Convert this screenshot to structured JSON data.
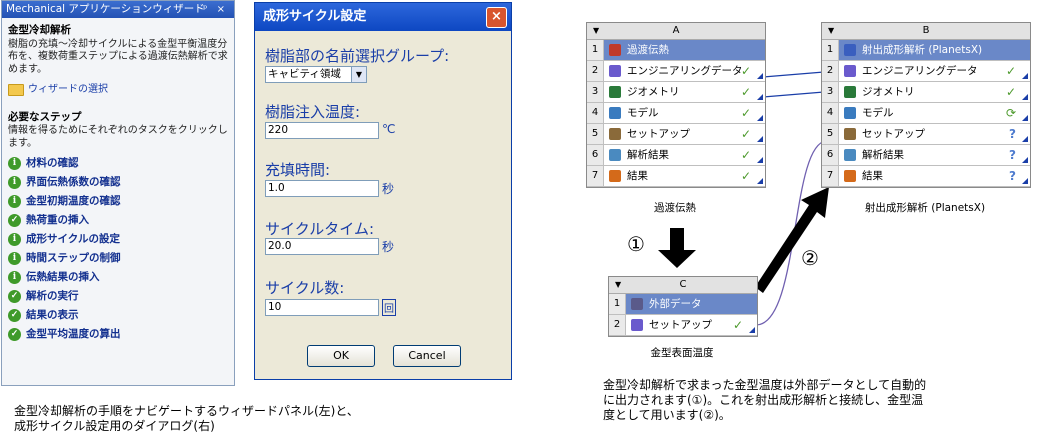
{
  "wizard": {
    "title": "Mechanical アプリケーションウィザード",
    "title_buttons": "ᵖ ×",
    "section_title": "金型冷却解析",
    "description": "樹脂の充填～冷却サイクルによる金型平衡温度分布を、複数荷重ステップによる過渡伝熱解析で求めます。",
    "wizard_link": "ウィザードの選択",
    "steps_title": "必要なステップ",
    "steps_desc": "情報を得るためにそれぞれのタスクをクリックします。",
    "steps": [
      {
        "label": "材料の確認",
        "icon": "info-icon"
      },
      {
        "label": "界面伝熱係数の確認",
        "icon": "info-icon"
      },
      {
        "label": "金型初期温度の確認",
        "icon": "info-icon"
      },
      {
        "label": "熱荷重の挿入",
        "icon": "check-icon"
      },
      {
        "label": "成形サイクルの設定",
        "icon": "info-icon"
      },
      {
        "label": "時間ステップの制御",
        "icon": "info-icon"
      },
      {
        "label": "伝熱結果の挿入",
        "icon": "info-icon"
      },
      {
        "label": "解析の実行",
        "icon": "check-icon"
      },
      {
        "label": "結果の表示",
        "icon": "check-icon"
      },
      {
        "label": "金型平均温度の算出",
        "icon": "check-icon"
      }
    ]
  },
  "dialog": {
    "title": "成形サイクル設定",
    "close": "×",
    "group_label": "樹脂部の名前選択グループ:",
    "group_value": "キャビティ領域",
    "temp_label": "樹脂注入温度:",
    "temp_value": "220",
    "temp_unit": "℃",
    "fill_label": "充填時間:",
    "fill_value": "1.0",
    "fill_unit": "秒",
    "cycle_label": "サイクルタイム:",
    "cycle_value": "20.0",
    "cycle_unit": "秒",
    "count_label": "サイクル数:",
    "count_value": "10",
    "count_unit": "回",
    "ok": "OK",
    "cancel": "Cancel"
  },
  "caption_left": [
    "金型冷却解析の手順をナビゲートするウィザードパネル(左)と、",
    "成形サイクル設定用のダイアログ(右)"
  ],
  "caption_right": [
    "金型冷却解析で求まった金型温度は外部データとして自動的",
    "に出力されます(①)。これを射出成形解析と接続し、金型温",
    "度として用います(②)。"
  ],
  "systemA": {
    "letter": "A",
    "name": "過渡伝熱",
    "rows": [
      {
        "n": "1",
        "text": "過渡伝熱",
        "status": ""
      },
      {
        "n": "2",
        "text": "エンジニアリングデータ",
        "status": "✓"
      },
      {
        "n": "3",
        "text": "ジオメトリ",
        "status": "✓"
      },
      {
        "n": "4",
        "text": "モデル",
        "status": "✓"
      },
      {
        "n": "5",
        "text": "セットアップ",
        "status": "✓"
      },
      {
        "n": "6",
        "text": "解析結果",
        "status": "✓"
      },
      {
        "n": "7",
        "text": "結果",
        "status": "✓"
      }
    ]
  },
  "systemB": {
    "letter": "B",
    "name": "射出成形解析 (PlanetsX)",
    "rows": [
      {
        "n": "1",
        "text": "射出成形解析 (PlanetsX)",
        "status": ""
      },
      {
        "n": "2",
        "text": "エンジニアリングデータ",
        "status": "✓"
      },
      {
        "n": "3",
        "text": "ジオメトリ",
        "status": "✓"
      },
      {
        "n": "4",
        "text": "モデル",
        "status": "⟳"
      },
      {
        "n": "5",
        "text": "セットアップ",
        "status": "?"
      },
      {
        "n": "6",
        "text": "解析結果",
        "status": "?"
      },
      {
        "n": "7",
        "text": "結果",
        "status": "?"
      }
    ]
  },
  "systemC": {
    "letter": "C",
    "name": "金型表面温度",
    "rows": [
      {
        "n": "1",
        "text": "外部データ",
        "status": ""
      },
      {
        "n": "2",
        "text": "セットアップ",
        "status": "✓"
      }
    ]
  },
  "arrow1": "①",
  "arrow2": "②"
}
